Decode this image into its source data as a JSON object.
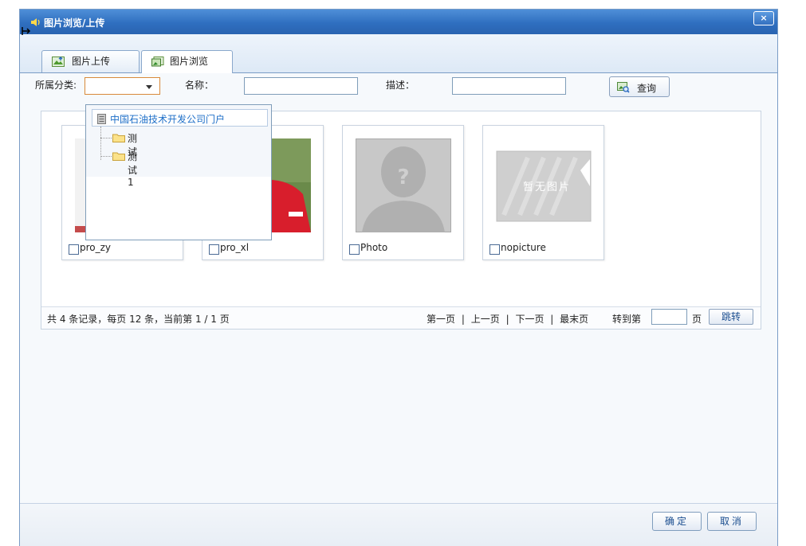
{
  "window": {
    "title": "图片浏览/上传",
    "close_label": "×"
  },
  "tabs": [
    {
      "label": "图片上传",
      "active": false,
      "icon": "image-upload-icon"
    },
    {
      "label": "图片浏览",
      "active": true,
      "icon": "image-browse-icon"
    }
  ],
  "filter": {
    "category_label": "所属分类:",
    "category_value": "",
    "name_label": "名称：",
    "name_value": "",
    "desc_label": "描述：",
    "desc_value": "",
    "query_label": "查询"
  },
  "category_tree": {
    "root": "中国石油技术开发公司门户",
    "children": [
      "测试",
      "测试1"
    ]
  },
  "images": [
    {
      "name": "pro_zy",
      "checked": false
    },
    {
      "name": "pro_xl",
      "checked": false
    },
    {
      "name": "Photo",
      "checked": false
    },
    {
      "name": "nopicture",
      "checked": false,
      "placeholder_text": "暂无图片"
    }
  ],
  "pager": {
    "summary": "共 4 条记录，每页 12 条，当前第 1 / 1 页",
    "first": "第一页",
    "prev": "上一页",
    "next": "下一页",
    "last": "最末页",
    "sep": "|",
    "goto_label": "转到第",
    "goto_value": "",
    "page_unit": "页",
    "jump_label": "跳转"
  },
  "footer": {
    "ok_label": "确定",
    "cancel_label": "取消"
  },
  "colors": {
    "title_bar": "#2f6fc0",
    "link": "#1e6fc8",
    "jersey_red": "#d81e2c"
  }
}
